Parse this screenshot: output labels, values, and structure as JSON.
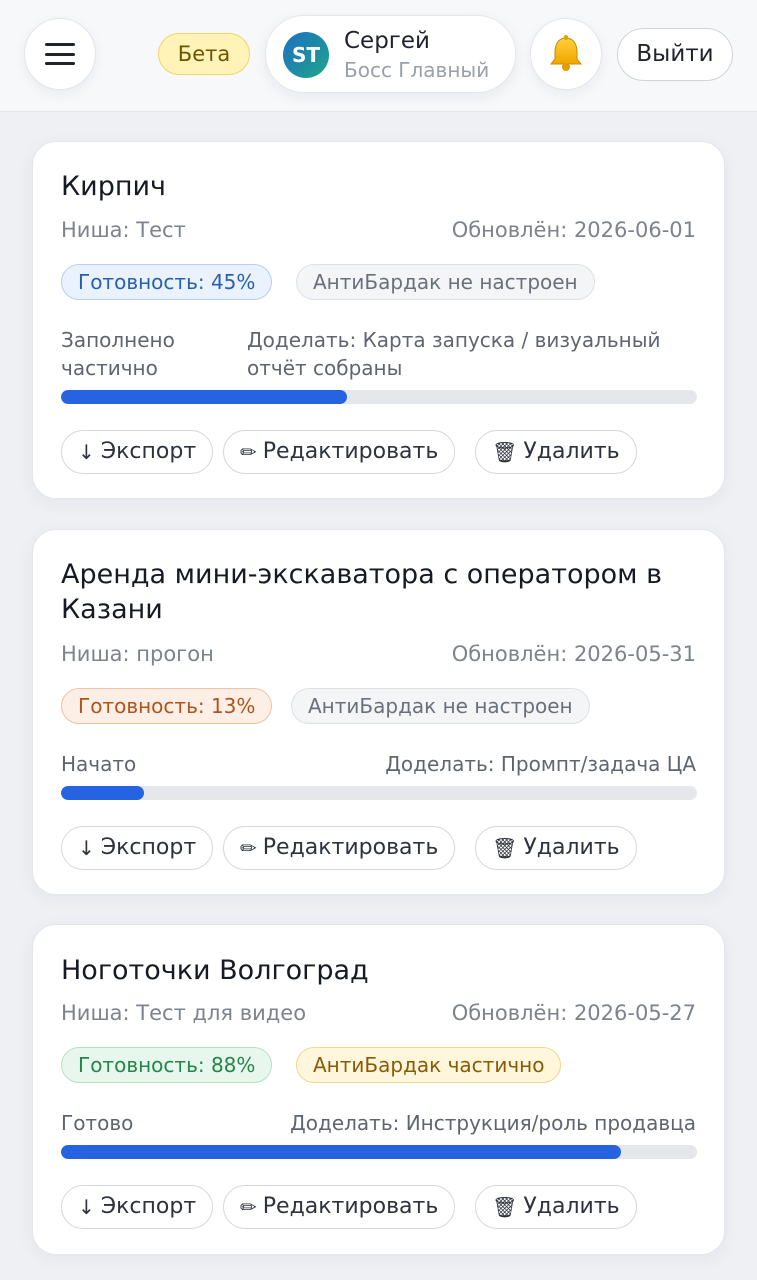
{
  "header": {
    "beta_label": "Бета",
    "user_initials": "ST",
    "user_name": "Сергей",
    "user_role": "Босс Главный",
    "logout_label": "Выйти"
  },
  "cards": [
    {
      "title": "Кирпич",
      "niche": "Ниша: Тест",
      "updated": "Обновлён: 2026-06-01",
      "readiness": "Готовность: 45%",
      "readiness_value": 45,
      "readiness_color": "blue",
      "antibardak": "АнтиБардак не настроен",
      "antibardak_color": "gray",
      "status": "Заполнено частично",
      "todo": "Доделать: Карта запуска / визуальный отчёт собраны",
      "export_label": "Экспорт",
      "edit_label": "Редактировать",
      "delete_label": "Удалить"
    },
    {
      "title": "Аренда мини-экскаватора с оператором в Казани",
      "niche": "Ниша: прогон",
      "updated": "Обновлён: 2026-05-31",
      "readiness": "Готовность: 13%",
      "readiness_value": 13,
      "readiness_color": "orange",
      "antibardak": "АнтиБардак не настроен",
      "antibardak_color": "gray",
      "status": "Начато",
      "todo": "Доделать: Промпт/задача ЦА",
      "export_label": "Экспорт",
      "edit_label": "Редактировать",
      "delete_label": "Удалить"
    },
    {
      "title": "Ноготочки Волгоград",
      "niche": "Ниша: Тест для видео",
      "updated": "Обновлён: 2026-05-27",
      "readiness": "Готовность: 88%",
      "readiness_value": 88,
      "readiness_color": "green",
      "antibardak": "АнтиБардак частично",
      "antibardak_color": "yellow",
      "status": "Готово",
      "todo": "Доделать: Инструкция/роль продавца",
      "export_label": "Экспорт",
      "edit_label": "Редактировать",
      "delete_label": "Удалить"
    }
  ],
  "colors": {
    "accent": "#2563e0",
    "beta_bg": "#fff3b8",
    "track": "#e5e7eb"
  },
  "icons": {
    "menu": "hamburger-icon",
    "bell": "bell-icon",
    "export": "download-arrow-icon",
    "edit": "pencil-icon",
    "delete": "trash-icon"
  }
}
